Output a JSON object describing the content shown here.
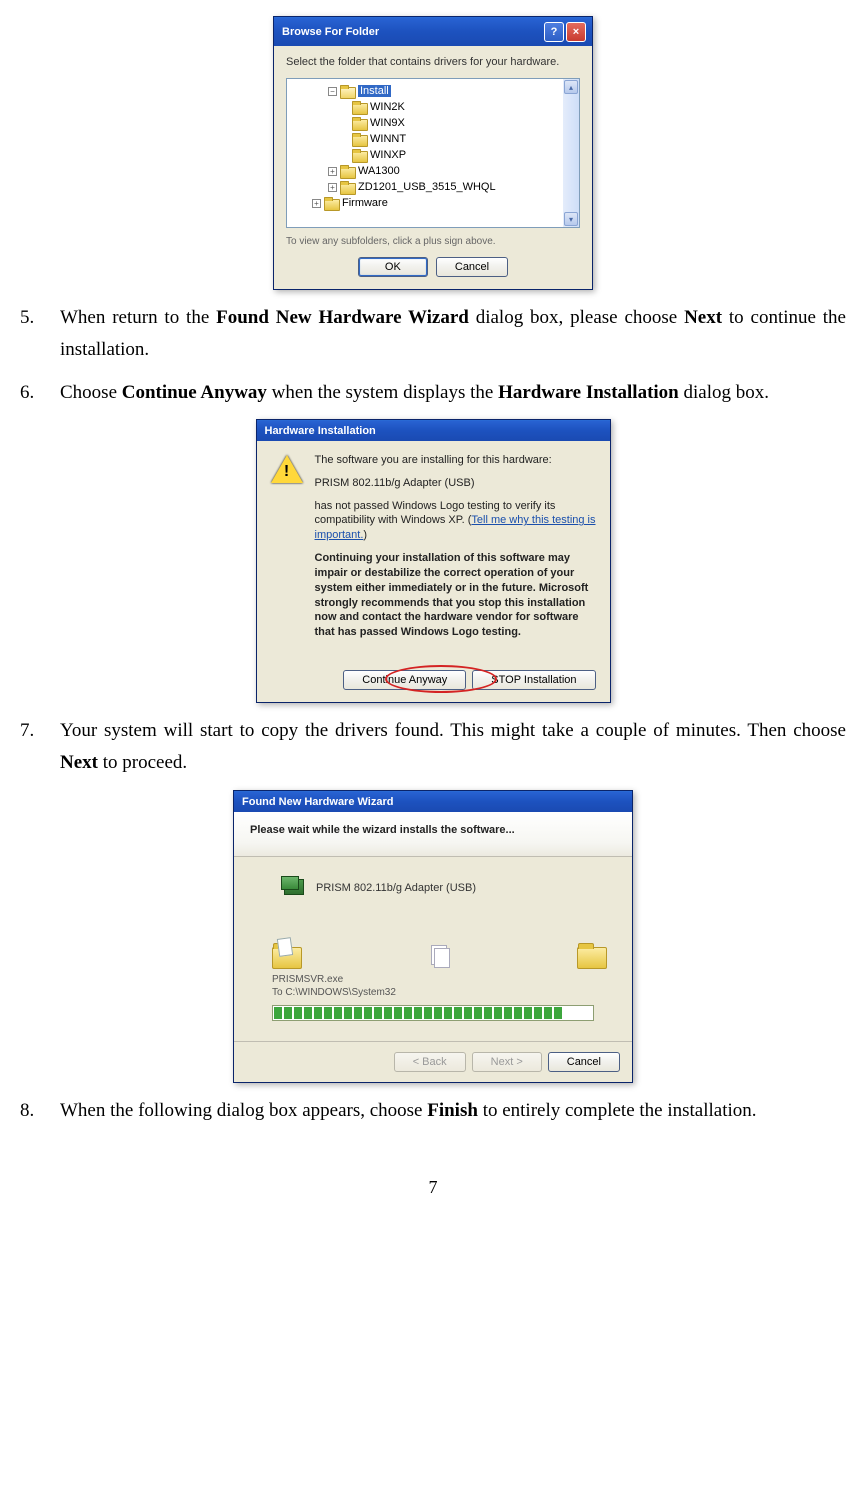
{
  "dialog1": {
    "title": "Browse For Folder",
    "instruction": "Select the folder that contains drivers for your hardware.",
    "tree": {
      "selected": "Install",
      "children": [
        "WIN2K",
        "WIN9X",
        "WINNT",
        "WINXP"
      ],
      "siblings": [
        "WA1300",
        "ZD1201_USB_3515_WHQL"
      ],
      "parent_sibling": "Firmware"
    },
    "note": "To view any subfolders, click a plus sign above.",
    "ok": "OK",
    "cancel": "Cancel"
  },
  "step5": {
    "num": "5.",
    "t1": "When return to the ",
    "b1": "Found New Hardware Wizard",
    "t2": " dialog box, please choose ",
    "b2": "Next",
    "t3": " to continue the installation."
  },
  "step6": {
    "num": "6.",
    "t1": "Choose ",
    "b1": "Continue Anyway",
    "t2": " when the system displays the ",
    "b2": "Hardware Installation",
    "t3": " dialog box."
  },
  "dialog2": {
    "title": "Hardware Installation",
    "l1": "The software you are installing for this hardware:",
    "l2": "PRISM 802.11b/g Adapter (USB)",
    "l3a": "has not passed Windows Logo testing to verify its compatibility with Windows XP. (",
    "link": "Tell me why this testing is important.",
    "l3b": ")",
    "warn": "Continuing your installation of this software may impair or destabilize the correct operation of your system either immediately or in the future. Microsoft strongly recommends that you stop this installation now and contact the hardware vendor for software that has passed Windows Logo testing.",
    "btnContinue": "Continue Anyway",
    "btnStop": "STOP Installation"
  },
  "step7": {
    "num": "7.",
    "t1": "Your system will start to copy the drivers found. This might take a couple of minutes. Then choose ",
    "b1": "Next",
    "t2": " to proceed."
  },
  "dialog3": {
    "title": "Found New Hardware Wizard",
    "header": "Please wait while the wizard installs the software...",
    "device": "PRISM 802.11b/g Adapter (USB)",
    "file": "PRISMSVR.exe",
    "dest": "To C:\\WINDOWS\\System32",
    "back": "< Back",
    "next": "Next >",
    "cancel": "Cancel"
  },
  "step8": {
    "num": "8.",
    "t1": "When the following dialog box appears, choose ",
    "b1": "Finish",
    "t2": " to entirely complete the installation."
  },
  "pageNumber": "7"
}
